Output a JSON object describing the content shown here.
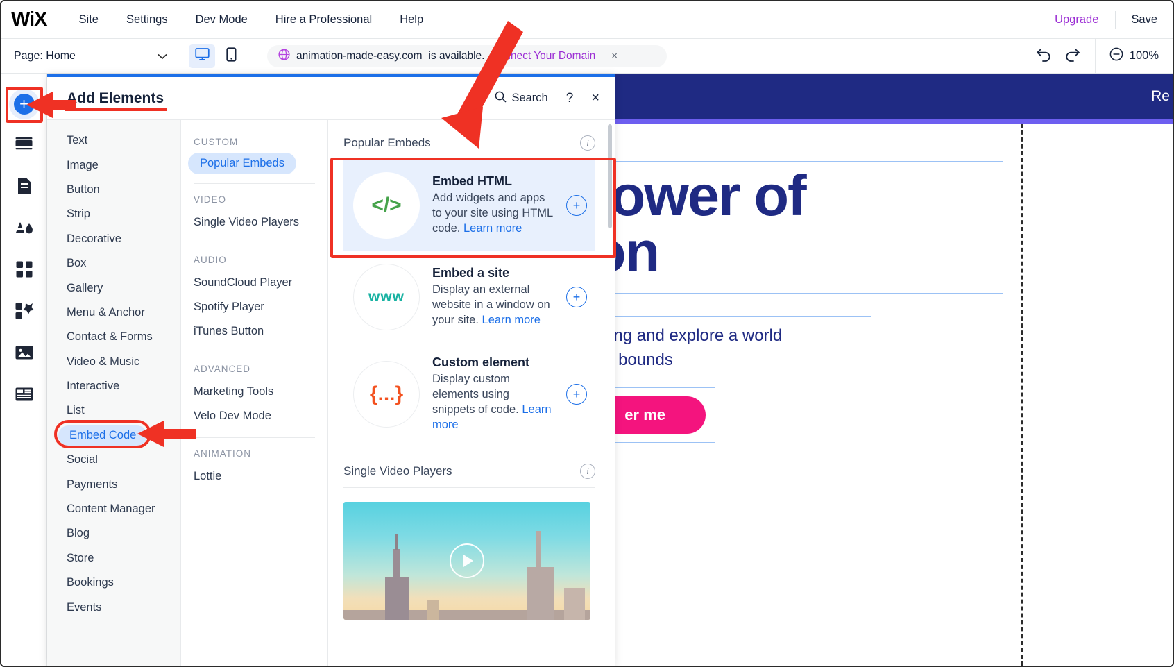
{
  "topbar": {
    "logo": "WiX",
    "menu": [
      "Site",
      "Settings",
      "Dev Mode",
      "Hire a Professional",
      "Help"
    ],
    "upgrade_label": "Upgrade",
    "save_label": "Save"
  },
  "toolbar": {
    "page_label": "Page: Home",
    "chevron": "⌄",
    "domain": {
      "name": "animation-made-easy.com",
      "status": "is available.",
      "cta": "Connect Your Domain",
      "close": "×"
    },
    "zoom_level": "100%"
  },
  "rail": {
    "items": [
      {
        "name": "add-elements",
        "icon": "plus-icon"
      },
      {
        "name": "site-layers",
        "icon": "strip-icon"
      },
      {
        "name": "pages",
        "icon": "page-icon"
      },
      {
        "name": "theme",
        "icon": "theme-icon"
      },
      {
        "name": "apps",
        "icon": "apps-grid-icon"
      },
      {
        "name": "app-market",
        "icon": "puzzle-icon"
      },
      {
        "name": "media",
        "icon": "image-icon"
      },
      {
        "name": "content-manager",
        "icon": "table-icon"
      }
    ],
    "add_glyph": "+"
  },
  "panel": {
    "title": "Add Elements",
    "search_label": "Search",
    "help_glyph": "?",
    "close_glyph": "×",
    "categories": [
      {
        "label": "Text",
        "selected": false
      },
      {
        "label": "Image",
        "selected": false
      },
      {
        "label": "Button",
        "selected": false
      },
      {
        "label": "Strip",
        "selected": false
      },
      {
        "label": "Decorative",
        "selected": false
      },
      {
        "label": "Box",
        "selected": false
      },
      {
        "label": "Gallery",
        "selected": false
      },
      {
        "label": "Menu & Anchor",
        "selected": false
      },
      {
        "label": "Contact & Forms",
        "selected": false
      },
      {
        "label": "Video & Music",
        "selected": false
      },
      {
        "label": "Interactive",
        "selected": false
      },
      {
        "label": "List",
        "selected": false
      },
      {
        "label": "Embed Code",
        "selected": true
      },
      {
        "label": "Social",
        "selected": false
      },
      {
        "label": "Payments",
        "selected": false
      },
      {
        "label": "Content Manager",
        "selected": false
      },
      {
        "label": "Blog",
        "selected": false
      },
      {
        "label": "Store",
        "selected": false
      },
      {
        "label": "Bookings",
        "selected": false
      },
      {
        "label": "Events",
        "selected": false
      }
    ],
    "subgroups": [
      {
        "label": "CUSTOM",
        "items": [
          {
            "label": "Popular Embeds",
            "selected": true
          }
        ]
      },
      {
        "label": "VIDEO",
        "items": [
          {
            "label": "Single Video Players",
            "selected": false
          }
        ]
      },
      {
        "label": "AUDIO",
        "items": [
          {
            "label": "SoundCloud Player",
            "selected": false
          },
          {
            "label": "Spotify Player",
            "selected": false
          },
          {
            "label": "iTunes Button",
            "selected": false
          }
        ]
      },
      {
        "label": "ADVANCED",
        "items": [
          {
            "label": "Marketing Tools",
            "selected": false
          },
          {
            "label": "Velo Dev Mode",
            "selected": false
          }
        ]
      },
      {
        "label": "ANIMATION",
        "items": [
          {
            "label": "Lottie",
            "selected": false
          }
        ]
      }
    ],
    "sections": [
      {
        "title": "Popular Embeds",
        "info_glyph": "i",
        "cards": [
          {
            "icon": "code-brackets-icon",
            "icon_text": "</>",
            "title": "Embed HTML",
            "desc": "Add widgets and apps to your site using HTML code.",
            "learn_more": "Learn more",
            "add_glyph": "+",
            "highlighted": true
          },
          {
            "icon": "www-icon",
            "icon_text": "www",
            "title": "Embed a site",
            "desc": "Display an external website in a window on your site.",
            "learn_more": "Learn more",
            "add_glyph": "+",
            "highlighted": false
          },
          {
            "icon": "curly-braces-icon",
            "icon_text": "{...}",
            "title": "Custom element",
            "desc": "Display custom elements using snippets of code.",
            "learn_more": "Learn more",
            "add_glyph": "+",
            "highlighted": false
          }
        ]
      },
      {
        "title": "Single Video Players",
        "info_glyph": "i",
        "cards": []
      }
    ],
    "video_thumb": {
      "name": "city-skyline-video-thumbnail",
      "play_glyph": "▶"
    }
  },
  "canvas": {
    "site_nav_text": "Re",
    "hero_lines": [
      "e Power of",
      "ation"
    ],
    "hero_sub_lines": [
      "ed storytelling and explore a world",
      "n knows no bounds"
    ],
    "hero_button_label": "er me",
    "plus_glyph": "+"
  },
  "annotations": {
    "color": "#ef3124",
    "targets": [
      "add-elements-rail-button",
      "embed-code-category",
      "embed-html-card",
      "add-elements-title"
    ]
  },
  "colors": {
    "accent_blue": "#1c6fe8",
    "highlight_bg": "#e8f0fd",
    "annotation_red": "#ef3124",
    "upgrade_purple": "#9c2fd4",
    "site_navy": "#1f2a83",
    "site_pink": "#f4147e",
    "code_green": "#46a34b",
    "www_teal": "#18b2a2",
    "curly_orange": "#f3511f"
  }
}
